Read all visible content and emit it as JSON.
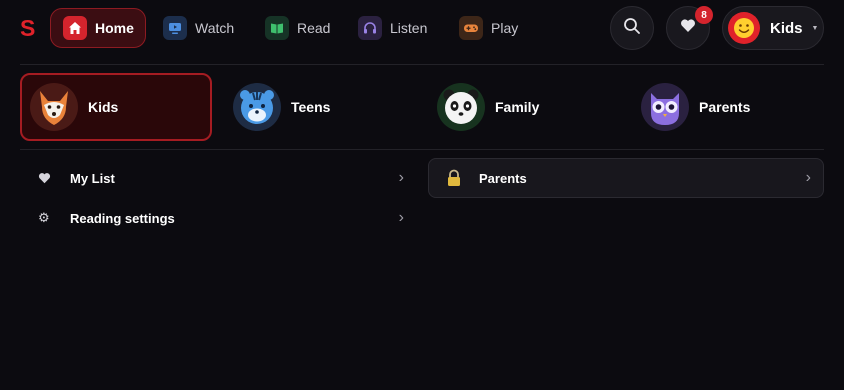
{
  "brand": {
    "logo": "S"
  },
  "nav": {
    "home": "Home",
    "watch": "Watch",
    "read": "Read",
    "listen": "Listen",
    "play": "Play"
  },
  "header": {
    "notification_count": "8",
    "profile_name": "Kids"
  },
  "profiles": [
    {
      "label": "Kids",
      "icon": "fox-avatar-icon",
      "selected": true
    },
    {
      "label": "Teens",
      "icon": "tiger-avatar-icon",
      "selected": false
    },
    {
      "label": "Family",
      "icon": "panda-avatar-icon",
      "selected": false
    },
    {
      "label": "Parents",
      "icon": "owl-avatar-icon",
      "selected": false
    }
  ],
  "menu": {
    "my_list": "My List",
    "reading_settings": "Reading settings",
    "parents": "Parents"
  },
  "colors": {
    "accent": "#e0222a",
    "background": "#0c0b10",
    "active_card": "#2a0709"
  }
}
